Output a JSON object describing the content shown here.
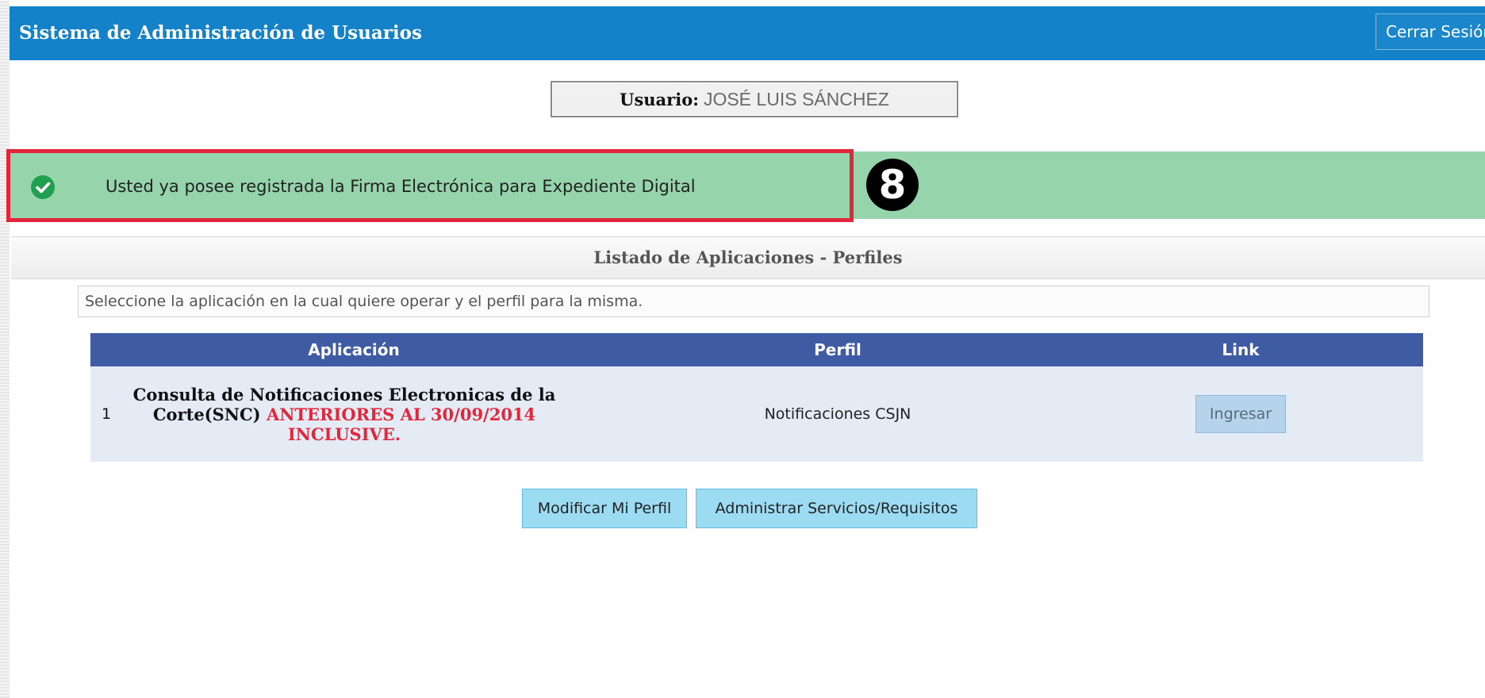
{
  "header": {
    "title": "Sistema de Administración de Usuarios",
    "logout_label": "Cerrar Sesión"
  },
  "user": {
    "label": "Usuario:",
    "name": "JOSÉ LUIS SÁNCHEZ"
  },
  "alert": {
    "icon": "check-circle-icon",
    "message": "Usted ya posee registrada la Firma Electrónica para Expediente Digital",
    "step_marker": "8"
  },
  "section": {
    "title": "Listado de Aplicaciones - Perfiles",
    "instructions": "Seleccione la aplicación en la cual quiere operar y el perfil para la misma."
  },
  "table": {
    "columns": [
      "Aplicación",
      "Perfil",
      "Link"
    ],
    "rows": [
      {
        "number": "1",
        "app_name": "Consulta de Notificaciones Electronicas de la Corte(SNC)",
        "app_note": "ANTERIORES AL 30/09/2014 INCLUSIVE.",
        "profile": "Notificaciones CSJN",
        "link_label": "Ingresar"
      }
    ]
  },
  "actions": {
    "edit_profile_label": "Modificar Mi Perfil",
    "manage_services_label": "Administrar Servicios/Requisitos"
  },
  "colors": {
    "header_bg": "#1482c8",
    "success_bg": "#96d4ab",
    "highlight_border": "#e1263b",
    "table_header_bg": "#3e5ba3",
    "table_row_bg": "#e4ebf5",
    "note_red": "#e4263a",
    "action_button_bg": "#9bdcf2"
  }
}
